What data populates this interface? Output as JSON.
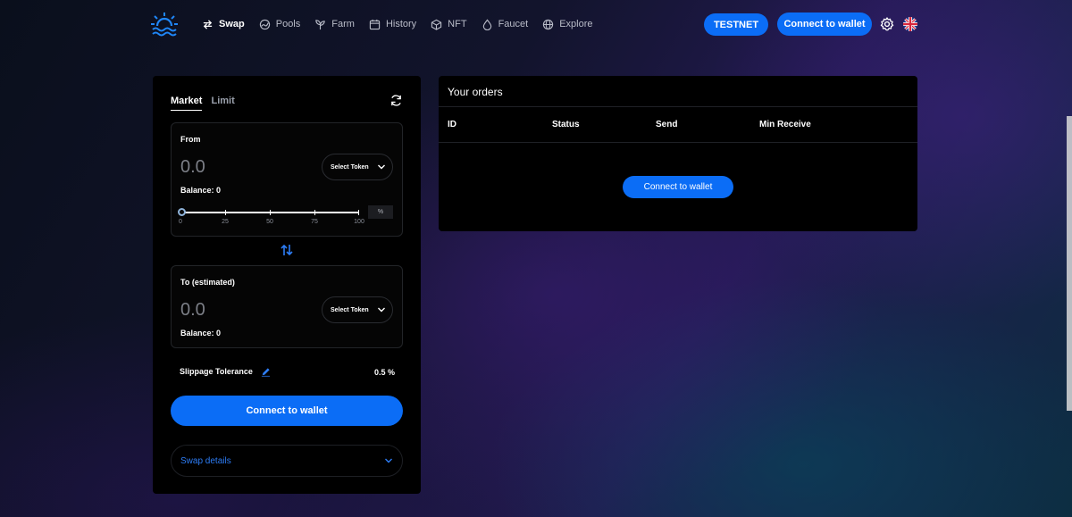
{
  "nav": {
    "items": [
      {
        "label": "Swap",
        "icon": "swap-arrows-icon",
        "active": true
      },
      {
        "label": "Pools",
        "icon": "pools-icon",
        "active": false
      },
      {
        "label": "Farm",
        "icon": "sprout-icon",
        "active": false
      },
      {
        "label": "History",
        "icon": "calendar-icon",
        "active": false
      },
      {
        "label": "NFT",
        "icon": "cube-icon",
        "active": false
      },
      {
        "label": "Faucet",
        "icon": "droplet-icon",
        "active": false
      },
      {
        "label": "Explore",
        "icon": "globe-icon",
        "active": false
      }
    ]
  },
  "header": {
    "network_label": "TESTNET",
    "connect_label": "Connect to wallet",
    "settings_icon": "gear-icon",
    "language_icon": "uk-flag-icon"
  },
  "swap": {
    "tabs": [
      "Market",
      "Limit"
    ],
    "from": {
      "label": "From",
      "amount": "0.0",
      "balance": "Balance: 0",
      "select_token": "Select Token"
    },
    "slider": {
      "ticks": [
        "0",
        "25",
        "50",
        "75",
        "100"
      ],
      "percent_placeholder": "%",
      "value": 0
    },
    "to": {
      "label": "To (estimated)",
      "amount": "0.0",
      "balance": "Balance: 0",
      "select_token": "Select Token"
    },
    "slippage_label": "Slippage Tolerance",
    "slippage_value": "0.5 %",
    "connect_label": "Connect to wallet",
    "details_label": "Swap details"
  },
  "orders": {
    "title": "Your orders",
    "columns": [
      "ID",
      "Status",
      "Send",
      "Min Receive"
    ],
    "connect_label": "Connect to wallet"
  },
  "colors": {
    "accent": "#0b6df6",
    "panel": "#000000"
  }
}
